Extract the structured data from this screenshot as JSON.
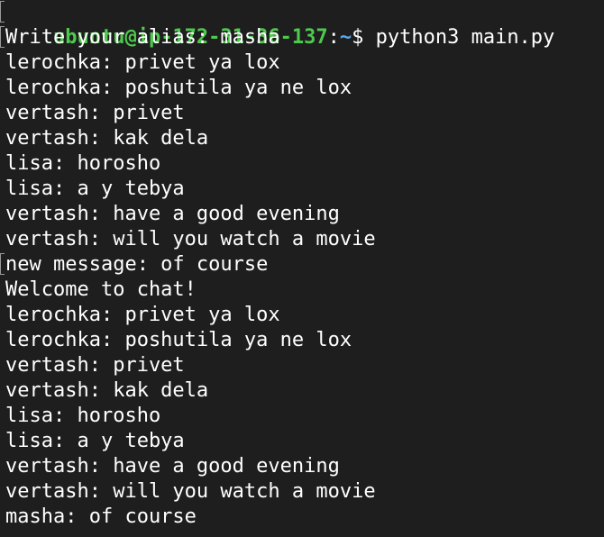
{
  "prompt": {
    "user_host": "ubuntu@ip-172-31-36-137",
    "separator": ":",
    "path": "~",
    "symbol": "$",
    "command": " python3 main.py"
  },
  "colors": {
    "background": "#1e1e1e",
    "text": "#ffffff",
    "user_host": "#4ec94e",
    "path": "#5aa9f0"
  },
  "lines": [
    {
      "text": "Write your alias: masha",
      "marked": true
    },
    {
      "text": "lerochka: privet ya lox",
      "marked": false
    },
    {
      "text": "lerochka: poshutila ya ne lox",
      "marked": false
    },
    {
      "text": "vertash: privet",
      "marked": false
    },
    {
      "text": "vertash: kak dela",
      "marked": false
    },
    {
      "text": "lisa: horosho",
      "marked": false
    },
    {
      "text": "lisa: a y tebya",
      "marked": false
    },
    {
      "text": "vertash: have a good evening",
      "marked": false
    },
    {
      "text": "vertash: will you watch a movie",
      "marked": false
    },
    {
      "text": "new message: of course",
      "marked": true
    },
    {
      "text": "Welcome to chat!",
      "marked": false
    },
    {
      "text": "lerochka: privet ya lox",
      "marked": false
    },
    {
      "text": "lerochka: poshutila ya ne lox",
      "marked": false
    },
    {
      "text": "vertash: privet",
      "marked": false
    },
    {
      "text": "vertash: kak dela",
      "marked": false
    },
    {
      "text": "lisa: horosho",
      "marked": false
    },
    {
      "text": "lisa: a y tebya",
      "marked": false
    },
    {
      "text": "vertash: have a good evening",
      "marked": false
    },
    {
      "text": "vertash: will you watch a movie",
      "marked": false
    },
    {
      "text": "masha: of course",
      "marked": false
    }
  ]
}
